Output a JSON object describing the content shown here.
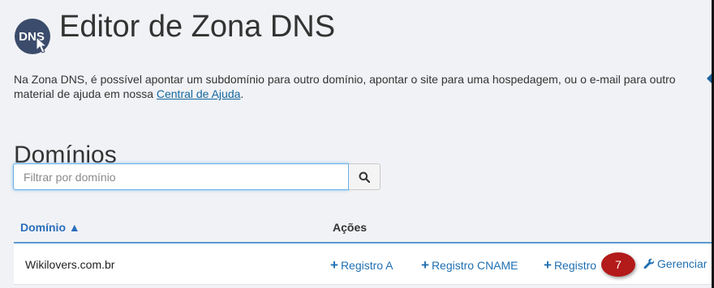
{
  "header": {
    "logo_text": "DNS",
    "title": "Editor de Zona DNS"
  },
  "description": {
    "line1": "Na Zona DNS, é possível apontar um subdomínio para outro domínio, apontar o site para uma hospedagem, ou o e-mail para outro",
    "line2_prefix": "material de ajuda em nossa ",
    "link": "Central de Ajuda",
    "line2_suffix": "."
  },
  "section": {
    "title": "Domínios"
  },
  "search": {
    "placeholder": "Filtrar por domínio",
    "value": ""
  },
  "table": {
    "columns": {
      "domain": "Domínio ▲",
      "actions": "Ações"
    },
    "rows": [
      {
        "domain": "Wikilovers.com.br",
        "actions": {
          "a_record": "Registro A",
          "cname_record": "Registro CNAME",
          "record": "Registro",
          "manage": "Gerenciar"
        }
      }
    ]
  },
  "annotation": {
    "badge": "7"
  },
  "colors": {
    "accent": "#1f6fb2",
    "badge": "#b31a1a",
    "logo": "#3b4b6b",
    "background": "#f1f2f5"
  }
}
